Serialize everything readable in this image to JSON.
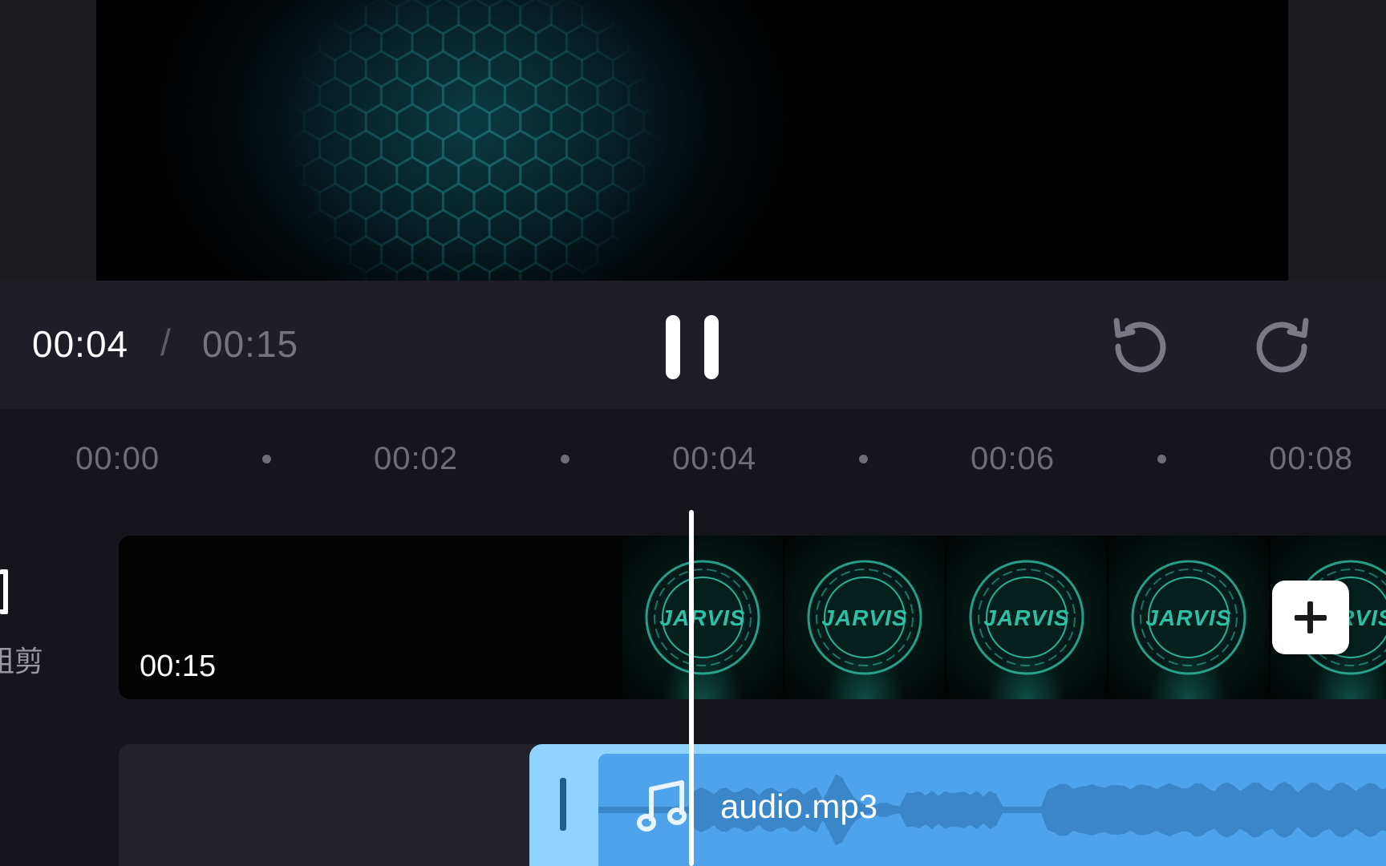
{
  "player": {
    "current_time": "00:04",
    "separator": "/",
    "total_time": "00:15"
  },
  "toolbar": {
    "pause_icon": "pause-icon",
    "undo_icon": "undo-icon",
    "redo_icon": "redo-icon"
  },
  "ruler": {
    "labels": [
      "00:00",
      "00:02",
      "00:04",
      "00:06",
      "00:08"
    ]
  },
  "side_panel": {
    "label": "粗剪"
  },
  "video_track": {
    "clip_duration": "00:15",
    "thumbnail_text": "JARVIS",
    "add_icon": "plus-icon"
  },
  "audio_track": {
    "file_name": "audio.mp3",
    "icon": "music-note-icon"
  },
  "colors": {
    "accent_audio": "#4fa3ea",
    "audio_frame": "#8fd3ff",
    "logo_teal": "#2fbfa6"
  }
}
